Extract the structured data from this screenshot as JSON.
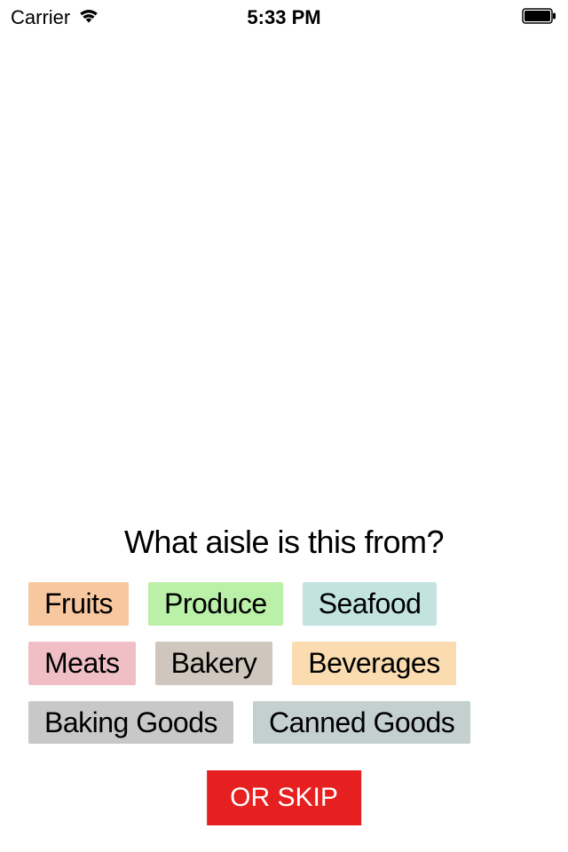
{
  "status_bar": {
    "carrier": "Carrier",
    "time": "5:33 PM"
  },
  "question": "What aisle is this from?",
  "tags": [
    {
      "label": "Fruits",
      "color": "#f7c7a0"
    },
    {
      "label": "Produce",
      "color": "#baf0a8"
    },
    {
      "label": "Seafood",
      "color": "#c2e3e0"
    },
    {
      "label": "Meats",
      "color": "#f0bfc6"
    },
    {
      "label": "Bakery",
      "color": "#cfc6bd"
    },
    {
      "label": "Beverages",
      "color": "#fadcb0"
    },
    {
      "label": "Baking Goods",
      "color": "#c8c8c8"
    },
    {
      "label": "Canned Goods",
      "color": "#c4d0cf"
    }
  ],
  "skip_label": "OR SKIP"
}
